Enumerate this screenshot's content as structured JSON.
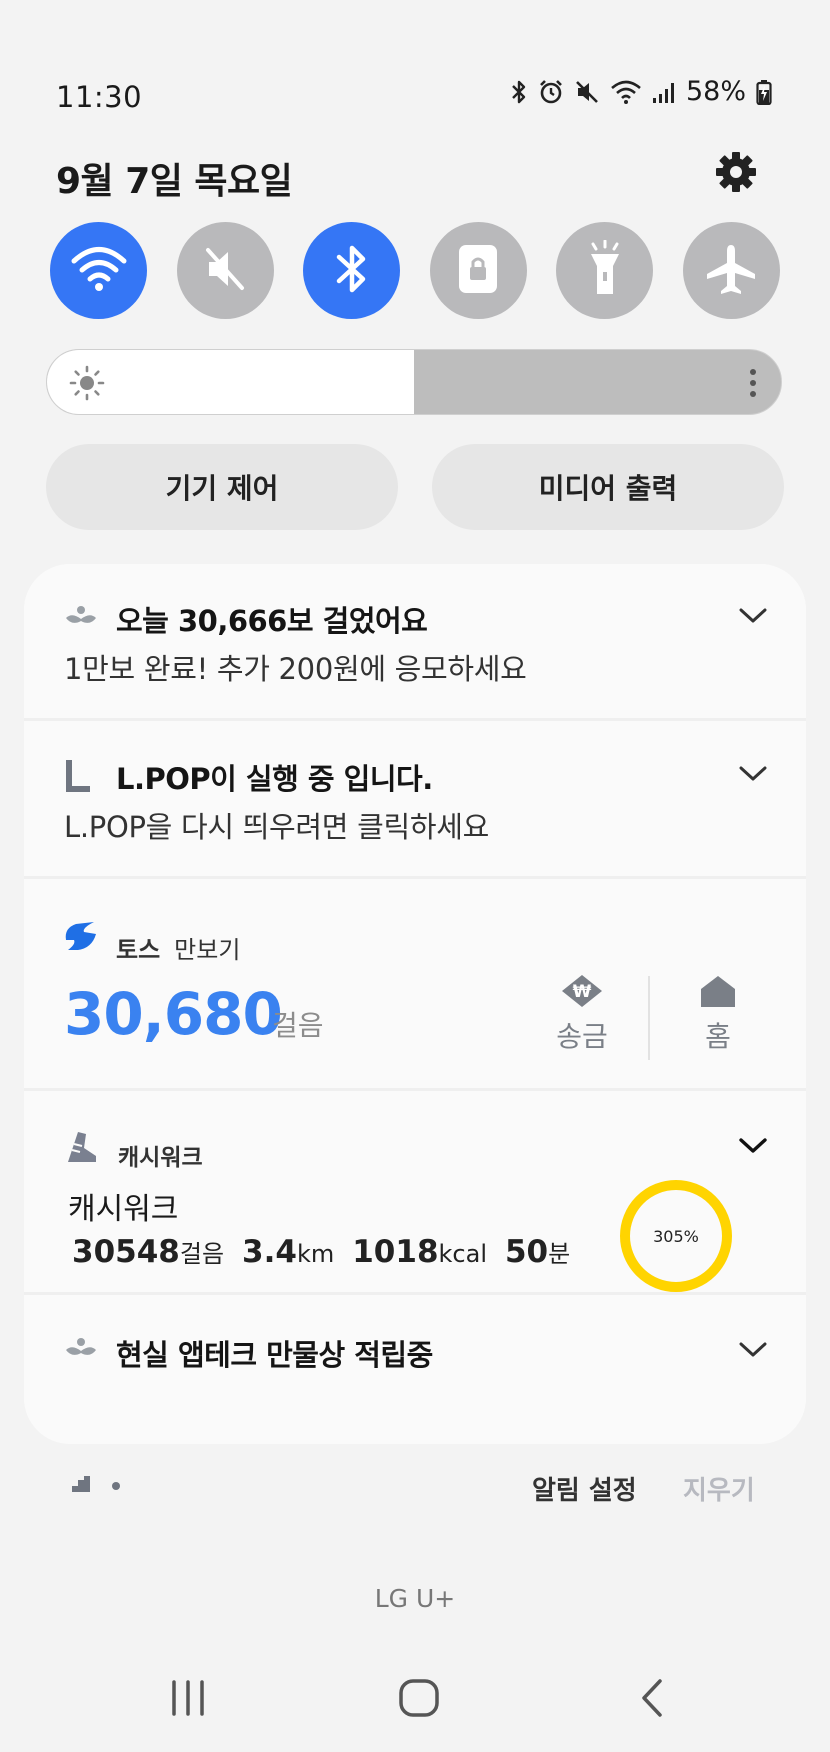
{
  "status_bar": {
    "time": "11:30",
    "battery_percent": "58%",
    "icons": [
      "bluetooth-icon",
      "alarm-icon",
      "mute-icon",
      "wifi-icon",
      "signal-icon",
      "battery-charging-icon"
    ]
  },
  "header": {
    "date": "9월 7일 목요일"
  },
  "quick_settings": [
    {
      "name": "wifi",
      "on": true
    },
    {
      "name": "sound-mute",
      "on": false
    },
    {
      "name": "bluetooth",
      "on": true
    },
    {
      "name": "screen-lock",
      "on": false
    },
    {
      "name": "flashlight",
      "on": false
    },
    {
      "name": "airplane-mode",
      "on": false
    }
  ],
  "brightness": {
    "level": 0.5
  },
  "buttons": {
    "device_control": "기기 제어",
    "media_output": "미디어 출력"
  },
  "notifications": {
    "steps_reward": {
      "title": "오늘 30,666보 걸었어요",
      "body": "1만보 완료! 추가 200원에 응모하세요"
    },
    "lpop": {
      "title": "L.POP이 실행 중 입니다.",
      "body": "L.POP을 다시 띄우려면 클릭하세요"
    },
    "toss": {
      "app": "토스",
      "feature": "만보기",
      "steps": "30,680",
      "steps_unit": "걸음",
      "send_label": "송금",
      "home_label": "홈"
    },
    "cashwalk": {
      "app": "캐시워크",
      "title": "캐시워크",
      "steps": "30548",
      "steps_unit": "걸음",
      "distance": "3.4",
      "distance_unit": "km",
      "calories": "1018",
      "calories_unit": "kcal",
      "minutes": "50",
      "minutes_unit": "분",
      "goal_percent": "305%"
    },
    "apptech": {
      "title": "현실 앱테크 만물상 적립중"
    }
  },
  "footer": {
    "notification_settings": "알림 설정",
    "clear": "지우기",
    "carrier": "LG U+"
  },
  "colors": {
    "toggle_on": "#3576f5",
    "toggle_off": "#b9b9bb",
    "toss_blue": "#3a82f0",
    "cashwalk_ring": "#ffd400"
  }
}
